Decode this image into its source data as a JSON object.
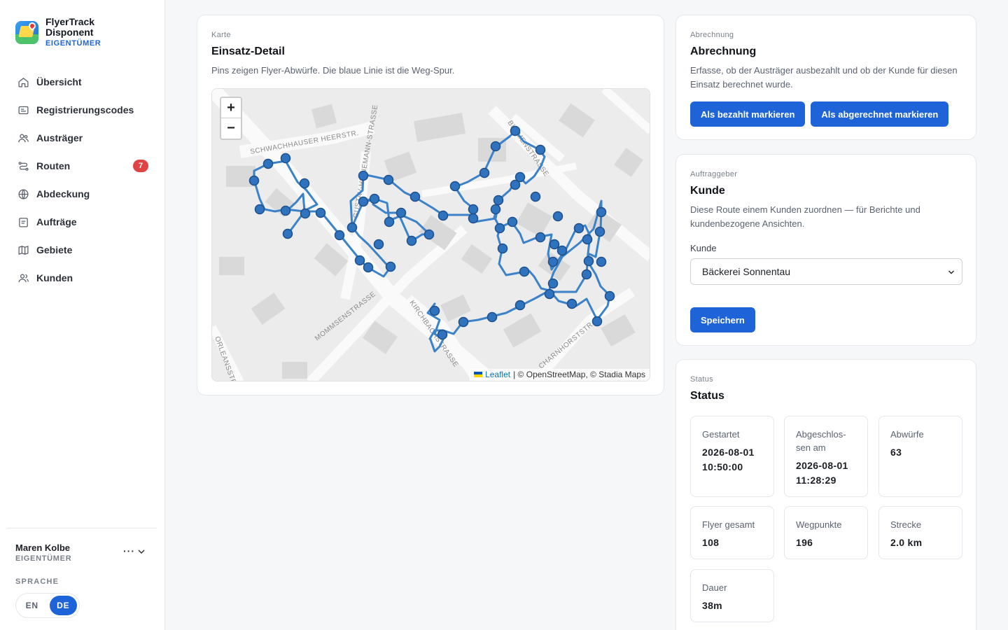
{
  "brand": {
    "name_line1": "FlyerTrack",
    "name_line2": "Disponent",
    "role": "EIGENTÜMER"
  },
  "nav": [
    {
      "label": "Übersicht",
      "icon": "home-icon"
    },
    {
      "label": "Registrierungscodes",
      "icon": "id-card-icon"
    },
    {
      "label": "Austräger",
      "icon": "users-icon"
    },
    {
      "label": "Routen",
      "icon": "route-icon",
      "badge": "7"
    },
    {
      "label": "Abdeckung",
      "icon": "globe-icon"
    },
    {
      "label": "Aufträge",
      "icon": "clipboard-icon"
    },
    {
      "label": "Gebiete",
      "icon": "map-icon"
    },
    {
      "label": "Kunden",
      "icon": "customers-icon"
    }
  ],
  "user": {
    "name": "Maren Kolbe",
    "role": "EIGENTÜMER",
    "more": "···"
  },
  "language": {
    "label": "SPRACHE",
    "options": [
      "EN",
      "DE"
    ],
    "selected": "DE"
  },
  "map_card": {
    "eyebrow": "Karte",
    "title": "Einsatz-Detail",
    "description": "Pins zeigen Flyer-Abwürfe. Die blaue Linie ist die Weg-Spur.",
    "zoom_in": "+",
    "zoom_out": "−",
    "attribution_link": "Leaflet",
    "attribution_text": "| © OpenStreetMap, © Stadia Maps",
    "streets": [
      "SCHWACHHAUSER HEERSTR.",
      "MOMMSENSTRASSE",
      "KIRCHBACHSTRASSE",
      "CHARNHORSTSTR.",
      "ORLEANSSTR.",
      "BLUMENSTRASSE",
      "GUSTAV-HEINEMANN-STRASSE"
    ],
    "route_color": "#3b82c9",
    "pin_color": "#2f72bd"
  },
  "billing": {
    "eyebrow": "Abrechnung",
    "title": "Abrechnung",
    "description": "Erfasse, ob der Austräger ausbezahlt und ob der Kunde für diesen Einsatz berechnet wurde.",
    "btn_paid": "Als bezahlt markieren",
    "btn_billed": "Als abgerechnet markieren"
  },
  "client": {
    "eyebrow": "Auftraggeber",
    "title": "Kunde",
    "description": "Diese Route einem Kunden zuordnen — für Berichte und kundenbezogene Ansichten.",
    "field_label": "Kunde",
    "selected": "Bäckerei Sonnentau",
    "save": "Speichern"
  },
  "status": {
    "eyebrow": "Status",
    "title": "Status",
    "stats": [
      {
        "label": "Gestartet",
        "value_line1": "2026-08-01",
        "value_line2": "10:50:00"
      },
      {
        "label": "Abgeschlos-sen am",
        "label_line1": "Abgeschlos-",
        "label_line2": "sen am",
        "value_line1": "2026-08-01",
        "value_line2": "11:28:29"
      },
      {
        "label": "Abwürfe",
        "value": "63"
      },
      {
        "label": "Flyer gesamt",
        "value": "108"
      },
      {
        "label": "Wegpunkte",
        "value": "196"
      },
      {
        "label": "Strecke",
        "value": "2.0 km"
      },
      {
        "label": "Dauer",
        "value": "38m"
      }
    ]
  },
  "colors": {
    "accent": "#1e63d8",
    "badge": "#e04343",
    "background": "#f6f7f9"
  }
}
